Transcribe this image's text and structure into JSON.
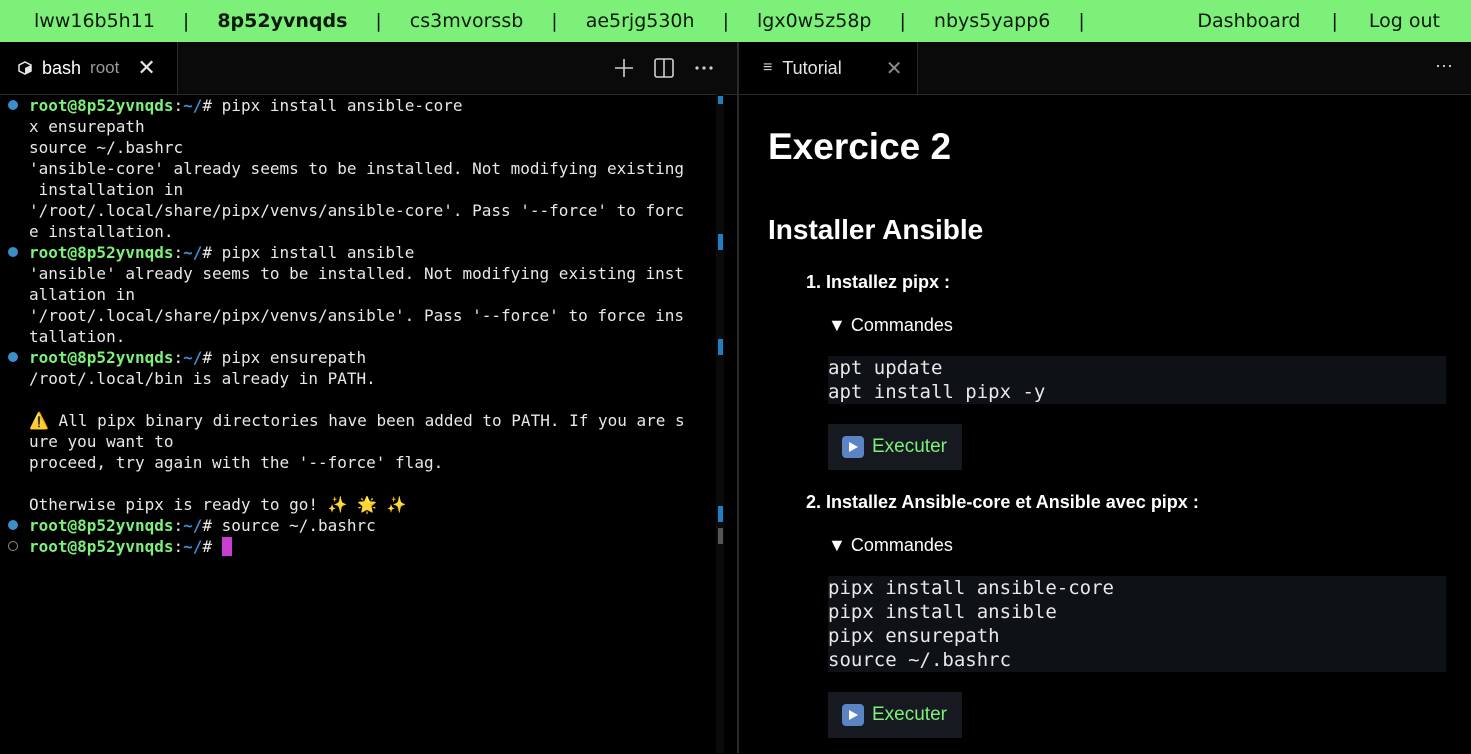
{
  "nav": {
    "hosts": [
      "lww16b5h11",
      "8p52yvnqds",
      "cs3mvorssb",
      "ae5rjg530h",
      "lgx0w5z58p",
      "nbys5yapp6"
    ],
    "active_host": "8p52yvnqds",
    "separator": "|",
    "dashboard": "Dashboard",
    "logout": "Log out"
  },
  "terminal_tab": {
    "name": "bash",
    "sub": "root",
    "close": "✕"
  },
  "terminal": {
    "prompt_user": "root@8p52yvnqds",
    "prompt_colon": ":",
    "prompt_path": "~/",
    "prompt_hash": "# ",
    "lines": [
      {
        "type": "prompt",
        "cmd": "pipx install ansible-core",
        "dot": "filled"
      },
      {
        "type": "out",
        "text": "x ensurepath"
      },
      {
        "type": "out",
        "text": "source ~/.bashrc"
      },
      {
        "type": "out",
        "text": "'ansible-core' already seems to be installed. Not modifying existing"
      },
      {
        "type": "out",
        "text": " installation in"
      },
      {
        "type": "out",
        "text": "'/root/.local/share/pipx/venvs/ansible-core'. Pass '--force' to forc"
      },
      {
        "type": "out",
        "text": "e installation."
      },
      {
        "type": "prompt",
        "cmd": "pipx install ansible",
        "dot": "filled"
      },
      {
        "type": "out",
        "text": "'ansible' already seems to be installed. Not modifying existing inst"
      },
      {
        "type": "out",
        "text": "allation in"
      },
      {
        "type": "out",
        "text": "'/root/.local/share/pipx/venvs/ansible'. Pass '--force' to force ins"
      },
      {
        "type": "out",
        "text": "tallation."
      },
      {
        "type": "prompt",
        "cmd": "pipx ensurepath",
        "dot": "filled"
      },
      {
        "type": "out",
        "text": "/root/.local/bin is already in PATH."
      },
      {
        "type": "out",
        "text": ""
      },
      {
        "type": "out",
        "text": "⚠️ All pipx binary directories have been added to PATH. If you are s"
      },
      {
        "type": "out",
        "text": "ure you want to"
      },
      {
        "type": "out",
        "text": "proceed, try again with the '--force' flag."
      },
      {
        "type": "out",
        "text": ""
      },
      {
        "type": "out",
        "text": "Otherwise pipx is ready to go! ✨ 🌟 ✨"
      },
      {
        "type": "prompt",
        "cmd": "source ~/.bashrc",
        "dot": "filled"
      },
      {
        "type": "prompt",
        "cmd": "",
        "dot": "empty",
        "cursor": true
      }
    ]
  },
  "tutorial_tab": {
    "name": "Tutorial",
    "close": "✕",
    "more": "⋯"
  },
  "tutorial": {
    "title": "Exercice 2",
    "subtitle": "Installer Ansible",
    "steps": [
      {
        "num": "1.",
        "label": "Installez pipx :",
        "summary": "▼ Commandes",
        "code": [
          "apt update",
          "apt install pipx -y"
        ],
        "exec": "Executer"
      },
      {
        "num": "2.",
        "label": "Installez Ansible-core et Ansible avec pipx :",
        "summary": "▼ Commandes",
        "code": [
          "pipx install ansible-core",
          "pipx install ansible",
          "pipx ensurepath",
          "source ~/.bashrc"
        ],
        "exec": "Executer"
      }
    ]
  },
  "colors": {
    "nav_bg": "#7df07a",
    "prompt_green": "#7df07a",
    "path_blue": "#3b8fd6",
    "cursor": "#c63fd0",
    "exec_label": "#7df07a"
  }
}
